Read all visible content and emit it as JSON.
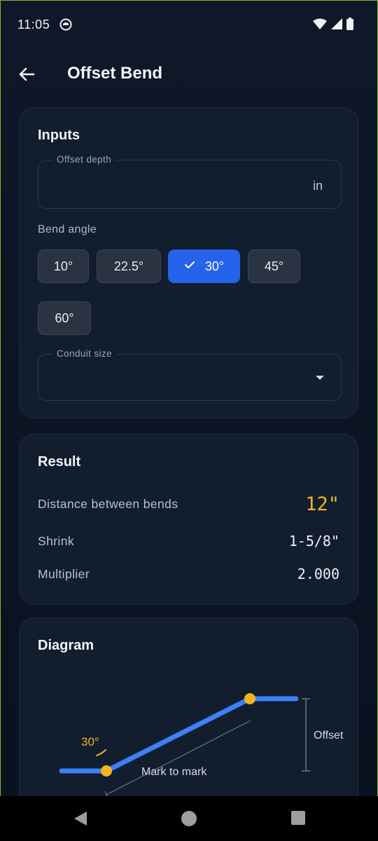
{
  "status": {
    "time": "11:05"
  },
  "appbar": {
    "title": "Offset Bend"
  },
  "inputs": {
    "heading": "Inputs",
    "offset_depth": {
      "label": "Offset depth",
      "value": "",
      "unit": "in"
    },
    "bend_angle": {
      "label": "Bend angle",
      "options": [
        "10°",
        "22.5°",
        "30°",
        "45°",
        "60°"
      ],
      "selected": "30°"
    },
    "conduit_size": {
      "label": "Conduit size",
      "value": ""
    }
  },
  "result": {
    "heading": "Result",
    "rows": [
      {
        "label": "Distance between bends",
        "value": "12\""
      },
      {
        "label": "Shrink",
        "value": "1-5/8\""
      },
      {
        "label": "Multiplier",
        "value": "2.000"
      }
    ]
  },
  "diagram": {
    "heading": "Diagram",
    "angle_label": "30°",
    "mark_label": "Mark to mark",
    "offset_label": "Offset"
  },
  "colors": {
    "accent": "#2563eb",
    "highlight": "#f4b320",
    "line": "#3b82f6"
  }
}
